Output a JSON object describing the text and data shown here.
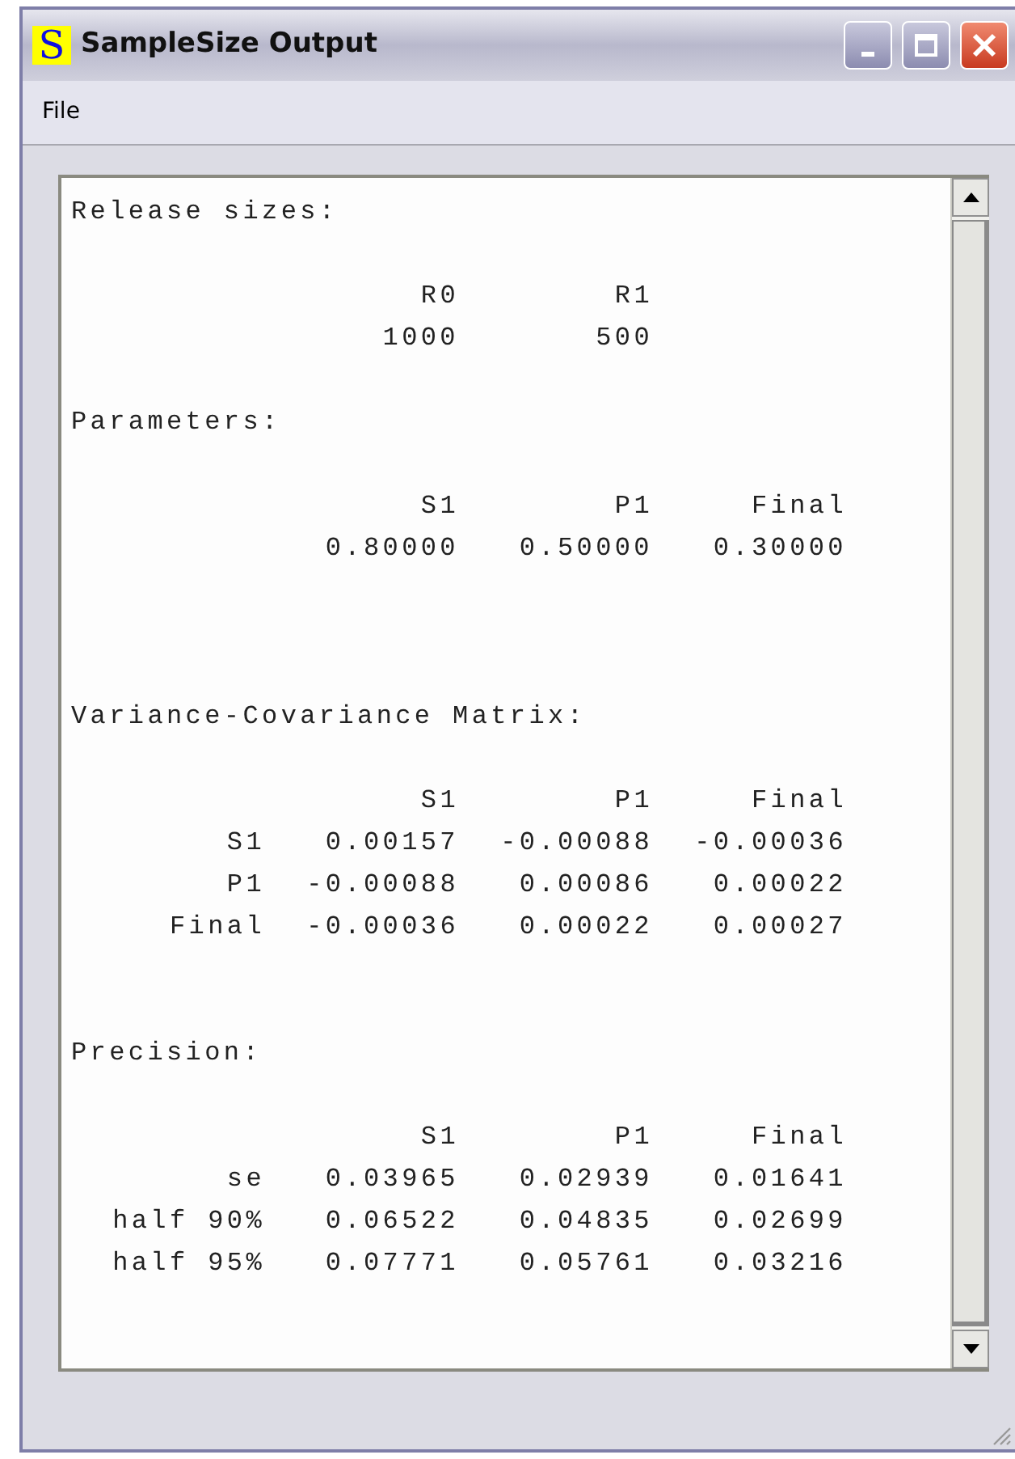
{
  "window": {
    "title": "SampleSize Output",
    "app_icon": "S"
  },
  "menu": [
    "File"
  ],
  "output": [
    {
      "kind": "heading",
      "text": "Release sizes:"
    },
    {
      "kind": "blank"
    },
    {
      "kind": "row",
      "cells": [
        "R0",
        "R1"
      ]
    },
    {
      "kind": "row",
      "cells": [
        "1000",
        "500"
      ]
    },
    {
      "kind": "blank"
    },
    {
      "kind": "heading",
      "text": "Parameters:"
    },
    {
      "kind": "blank"
    },
    {
      "kind": "row",
      "cells": [
        "S1",
        "P1",
        "Final"
      ]
    },
    {
      "kind": "row",
      "cells": [
        "0.80000",
        "0.50000",
        "0.30000"
      ]
    },
    {
      "kind": "blank"
    },
    {
      "kind": "blank"
    },
    {
      "kind": "blank"
    },
    {
      "kind": "heading",
      "text": "Variance-Covariance Matrix:"
    },
    {
      "kind": "blank"
    },
    {
      "kind": "row",
      "cells": [
        "S1",
        "P1",
        "Final"
      ]
    },
    {
      "kind": "row",
      "label": "S1",
      "cells": [
        "0.00157",
        "-0.00088",
        "-0.00036"
      ]
    },
    {
      "kind": "row",
      "label": "P1",
      "cells": [
        "-0.00088",
        "0.00086",
        "0.00022"
      ]
    },
    {
      "kind": "row",
      "label": "Final",
      "cells": [
        "-0.00036",
        "0.00022",
        "0.00027"
      ]
    },
    {
      "kind": "blank"
    },
    {
      "kind": "blank"
    },
    {
      "kind": "heading",
      "text": "Precision:"
    },
    {
      "kind": "blank"
    },
    {
      "kind": "row",
      "cells": [
        "S1",
        "P1",
        "Final"
      ]
    },
    {
      "kind": "row",
      "label": "se",
      "cells": [
        "0.03965",
        "0.02939",
        "0.01641"
      ]
    },
    {
      "kind": "row",
      "label": "half 90%",
      "cells": [
        "0.06522",
        "0.04835",
        "0.02699"
      ]
    },
    {
      "kind": "row",
      "label": "half 95%",
      "cells": [
        "0.07771",
        "0.05761",
        "0.03216"
      ]
    }
  ]
}
